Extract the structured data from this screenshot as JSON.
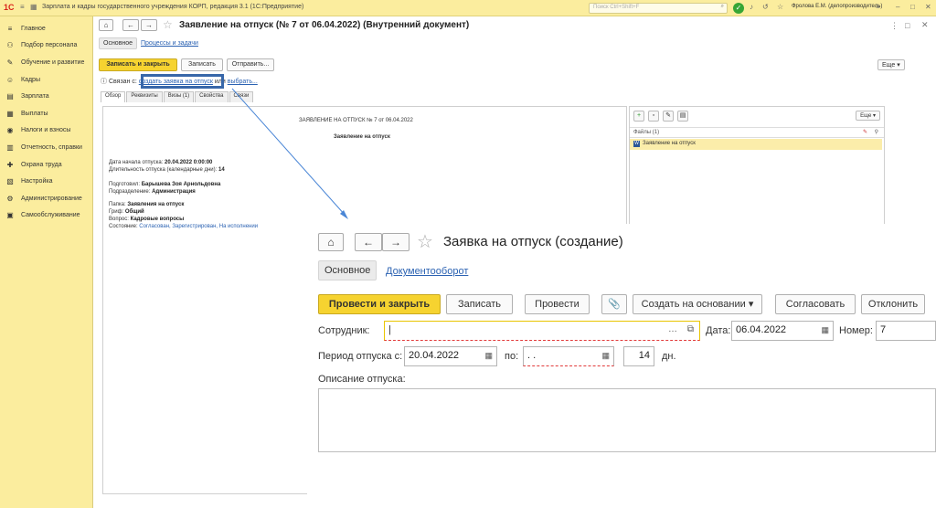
{
  "app": {
    "logo": "1С",
    "window_title": "Зарплата и кадры государственного учреждения КОРП, редакция 3.1  (1С:Предприятие)",
    "search_placeholder": "Поиск Ctrl+Shift+F",
    "user": "Фролова Е.М. (делопроизводитель)"
  },
  "sidebar": {
    "items": [
      {
        "label": "Главное",
        "icon": "≡"
      },
      {
        "label": "Подбор персонала",
        "icon": "⚇"
      },
      {
        "label": "Обучение и развитие",
        "icon": "✎"
      },
      {
        "label": "Кадры",
        "icon": "☺"
      },
      {
        "label": "Зарплата",
        "icon": "▤"
      },
      {
        "label": "Выплаты",
        "icon": "▦"
      },
      {
        "label": "Налоги и взносы",
        "icon": "◉"
      },
      {
        "label": "Отчетность, справки",
        "icon": "▥"
      },
      {
        "label": "Охрана труда",
        "icon": "✚"
      },
      {
        "label": "Настройка",
        "icon": "▧"
      },
      {
        "label": "Администрирование",
        "icon": "⚙"
      },
      {
        "label": "Самообслуживание",
        "icon": "▣"
      }
    ]
  },
  "back": {
    "title": "Заявление на отпуск (№ 7 от 06.04.2022) (Внутренний документ)",
    "tab_main": "Основное",
    "tab_processes": "Процессы и задачи",
    "buttons": {
      "save_close": "Записать и закрыть",
      "save": "Записать",
      "send": "Отправить...",
      "more": "Еще"
    },
    "link_prefix": "Связан с:",
    "link_create": "создать заявка на отпуск",
    "link_or": "или",
    "link_choose": "выбрать...",
    "subtabs": [
      "Обзор",
      "Реквизиты",
      "Визы (1)",
      "Свойства",
      "Связи"
    ],
    "preview": {
      "header": "ЗАЯВЛЕНИЕ НА ОТПУСК № 7 от 06.04.2022",
      "subheader": "Заявление на отпуск",
      "start_label": "Дата начала отпуска:",
      "start_value": "20.04.2022 0:00:00",
      "duration_label": "Длительность отпуска (календарные дни):",
      "duration_value": "14",
      "prepared_label": "Подготовил:",
      "prepared_value": "Барышева Зоя Арнольдовна",
      "dept_label": "Подразделение:",
      "dept_value": "Администрация",
      "folder_label": "Папка:",
      "folder_value": "Заявления на отпуск",
      "grif_label": "Гриф:",
      "grif_value": "Общий",
      "question_label": "Вопрос:",
      "question_value": "Кадровые вопросы",
      "state_label": "Состояние:",
      "state_value": "Согласован, Зарегистрирован, На исполнении"
    },
    "files": {
      "more": "Еще",
      "header": "Файлы (1)",
      "file_name": "Заявление на отпуск",
      "file_icon": "W"
    }
  },
  "front": {
    "title": "Заявка на отпуск (создание)",
    "tab_main": "Основное",
    "tab_docflow": "Документооборот",
    "buttons": {
      "post_close": "Провести и закрыть",
      "save": "Записать",
      "post": "Провести",
      "create_based": "Создать на основании",
      "approve": "Согласовать",
      "reject": "Отклонить"
    },
    "employee_label": "Сотрудник:",
    "employee_value": "",
    "date_label": "Дата:",
    "date_value": "06.04.2022",
    "number_label": "Номер:",
    "number_value": "7",
    "period_label": "Период отпуска с:",
    "period_from": "20.04.2022",
    "period_to_label": "по:",
    "period_to": " .  .",
    "days_value": "14",
    "days_label": "дн.",
    "desc_label": "Описание отпуска:"
  },
  "colors": {
    "accent_yellow": "#f6d330",
    "sidebar_bg": "#fbed9e",
    "link": "#2b62b2",
    "highlight": "#3867a9"
  }
}
